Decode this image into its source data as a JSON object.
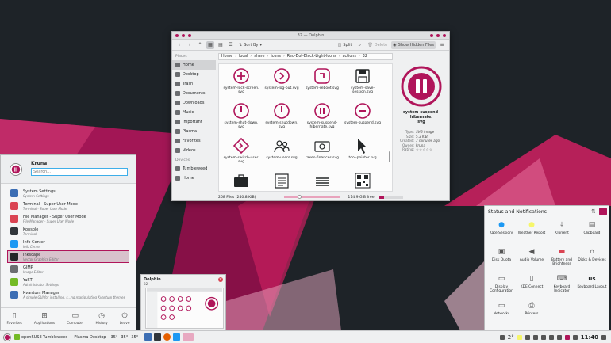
{
  "colors": {
    "accent": "#b0155a",
    "wallpaper_dark": "#1e2328",
    "wallpaper_red": "#b0155a"
  },
  "dolphin": {
    "title": "32 — Dolphin",
    "toolbar": {
      "sort": "Sort By",
      "split": "Split",
      "delete": "Delete",
      "hidden_files": "Show Hidden Files"
    },
    "places_header": "Places",
    "places": [
      "Home",
      "Desktop",
      "Trash",
      "Documents",
      "Downloads",
      "Music",
      "Important",
      "Plasma",
      "Favorites",
      "Videos"
    ],
    "devices_header": "Devices",
    "devices": [
      "Tumbleweed",
      "Home"
    ],
    "breadcrumbs": [
      "Home",
      "local",
      "share",
      "icons",
      "Red-Dot-Black-Light-Icons",
      "actions",
      "32"
    ],
    "files": [
      {
        "name": "system-lock-screen.\nsvg",
        "icon": "plus-icon"
      },
      {
        "name": "system-log-out.svg",
        "icon": "arrow-right-circle-icon"
      },
      {
        "name": "system-reboot.svg",
        "icon": "reboot-icon"
      },
      {
        "name": "system-save-\nsession.svg",
        "icon": "floppy-icon"
      },
      {
        "name": "system-shut-down.\nsvg",
        "icon": "power-icon"
      },
      {
        "name": "system-shutdown.\nsvg",
        "icon": "power-icon"
      },
      {
        "name": "system-suspend-\nhibernate.svg",
        "icon": "pause-icon"
      },
      {
        "name": "system-suspend.svg",
        "icon": "minus-circle-icon"
      },
      {
        "name": "system-switch-user.\nsvg",
        "icon": "switch-user-icon"
      },
      {
        "name": "system-users.svg",
        "icon": "users-icon"
      },
      {
        "name": "taxes-finances.svg",
        "icon": "camera-icon"
      },
      {
        "name": "tool-pointer.svg",
        "icon": "pointer-icon"
      },
      {
        "name": "",
        "icon": "briefcase-icon"
      },
      {
        "name": "",
        "icon": "document-icon"
      },
      {
        "name": "",
        "icon": "stack-icon"
      },
      {
        "name": "",
        "icon": "qr-icon"
      }
    ],
    "info": {
      "name": "system-suspend-hibernate.\nsvg",
      "rows": [
        {
          "k": "Type:",
          "v": "SVG image"
        },
        {
          "k": "Size:",
          "v": "5.3 KiB"
        },
        {
          "k": "Created:",
          "v": "7 minutes ago"
        },
        {
          "k": "Owner:",
          "v": "kruna"
        },
        {
          "k": "Rating:",
          "v": "☆☆☆☆☆"
        }
      ]
    },
    "status_count": "268 Files (240.8 KiB)",
    "status_free": "114.9 GiB free",
    "zoom_level": 0.25,
    "disk_used_fraction": 0.2
  },
  "kickoff": {
    "username": "Kruna",
    "search_placeholder": "Search...",
    "items": [
      {
        "title": "System Settings",
        "sub": "System Settings",
        "color": "#3c6eb4"
      },
      {
        "title": "Terminal - Super User Mode",
        "sub": "Terminal - Super User Mode",
        "color": "#da4453"
      },
      {
        "title": "File Manager - Super User Mode",
        "sub": "File Manager - Super User Mode",
        "color": "#da4453"
      },
      {
        "title": "Konsole",
        "sub": "Terminal",
        "color": "#31363b"
      },
      {
        "title": "Info Center",
        "sub": "Info Center",
        "color": "#1d99f3"
      },
      {
        "title": "Inkscape",
        "sub": "Vector Graphics Editor",
        "color": "#232627"
      },
      {
        "title": "GIMP",
        "sub": "Image Editor",
        "color": "#6c6e70"
      },
      {
        "title": "YaST",
        "sub": "Administrator Settings",
        "color": "#73ba25"
      },
      {
        "title": "Kvantum Manager",
        "sub": "A simple GUI for installing, s...nd manipulating Kvantum themes",
        "color": "#3c6eb4"
      }
    ],
    "selected_index": 5,
    "tabs": [
      {
        "label": "Favorites",
        "icon": "bookmark-icon",
        "glyph": "▯"
      },
      {
        "label": "Applications",
        "icon": "grid-icon",
        "glyph": "⊞"
      },
      {
        "label": "Computer",
        "icon": "monitor-icon",
        "glyph": "▭"
      },
      {
        "label": "History",
        "icon": "clock-icon",
        "glyph": "◷"
      },
      {
        "label": "Leave",
        "icon": "power-icon",
        "glyph": "⏻"
      }
    ]
  },
  "preview": {
    "title": "Dolphin",
    "subtitle": "32",
    "close": "×"
  },
  "tray": {
    "title": "Status and Notifications",
    "settings_glyph": "⇅",
    "items": [
      {
        "label": "Kate Sessions",
        "icon": "kate-icon",
        "glyph": "●",
        "color": "#1d99f3"
      },
      {
        "label": "Weather Report",
        "icon": "sun-icon",
        "glyph": "●",
        "color": "#f6f66a"
      },
      {
        "label": "KTorrent",
        "icon": "download-icon",
        "glyph": "⤓",
        "color": "#555"
      },
      {
        "label": "Clipboard",
        "icon": "clipboard-icon",
        "glyph": "▤",
        "color": "#555"
      },
      {
        "label": "Disk Quota",
        "icon": "disk-icon",
        "glyph": "▣",
        "color": "#555"
      },
      {
        "label": "Audio Volume",
        "icon": "speaker-icon",
        "glyph": "◀",
        "color": "#555"
      },
      {
        "label": "Battery and Brightness",
        "icon": "battery-icon",
        "glyph": "▬",
        "color": "#da4453"
      },
      {
        "label": "Disks & Devices",
        "icon": "usb-icon",
        "glyph": "⌂",
        "color": "#555"
      },
      {
        "label": "Display Configuration",
        "icon": "display-icon",
        "glyph": "▭",
        "color": "#555"
      },
      {
        "label": "KDE Connect",
        "icon": "phone-icon",
        "glyph": "▯",
        "color": "#555"
      },
      {
        "label": "Keyboard Indicator",
        "icon": "keyboard-icon",
        "glyph": "⌨",
        "color": "#555"
      },
      {
        "label": "Keyboard Layout",
        "icon": "keyboard-layout-icon",
        "glyph": "us",
        "color": "#232627"
      },
      {
        "label": "Networks",
        "icon": "network-icon",
        "glyph": "▭",
        "color": "#555"
      },
      {
        "label": "Printers",
        "icon": "printer-icon",
        "glyph": "⎙",
        "color": "#555"
      }
    ]
  },
  "taskbar": {
    "distro": "openSUSE-Tumbleweed",
    "desktop": "Plasma Desktop",
    "temps": [
      "35°",
      "35°",
      "35°"
    ],
    "weather_temp": "2°",
    "clock": "11:40"
  }
}
